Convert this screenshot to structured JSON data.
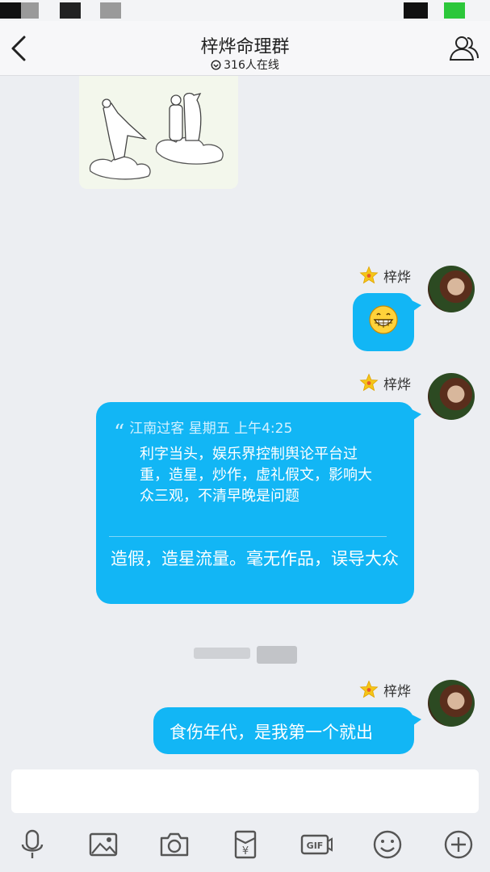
{
  "header": {
    "title": "梓烨命理群",
    "online": "316人在线"
  },
  "messages": [
    {
      "sender": "梓烨",
      "type": "emoji",
      "emoji_icon": "grinning-face-icon"
    },
    {
      "sender": "梓烨",
      "type": "reply",
      "quote_author": "江南过客",
      "quote_time": "星期五 上午4:25",
      "quote_text": "利字当头，娱乐界控制舆论平台过重，造星，炒作，虚礼假文，影响大众三观，不清早晚是问题",
      "reply_text": "造假，造星流量。毫无作品，误导大众"
    },
    {
      "sender": "梓烨",
      "type": "text",
      "text": "食伤年代，是我第一个就出"
    }
  ],
  "toolbar": [
    "microphone-icon",
    "image-icon",
    "camera-icon",
    "red-packet-icon",
    "gif-icon",
    "emoji-icon",
    "plus-icon"
  ],
  "colors": {
    "bubble": "#12b6f5",
    "background": "#eceef2",
    "header": "#f7f7f9"
  }
}
